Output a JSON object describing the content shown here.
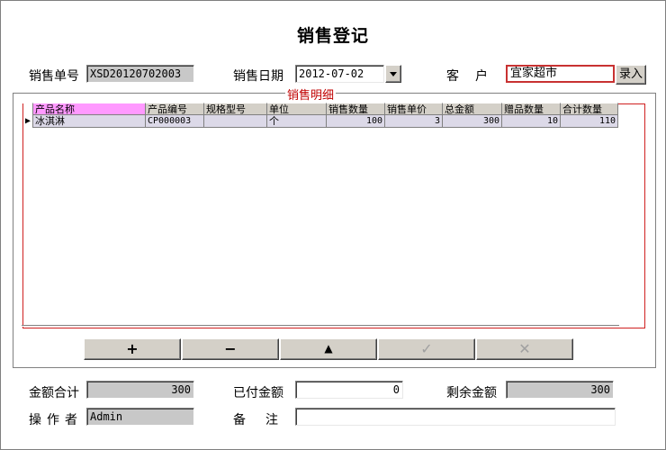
{
  "title": "销售登记",
  "header": {
    "order_no_label": "销售单号",
    "order_no": "XSD20120702003",
    "date_label": "销售日期",
    "date": "2012-07-02",
    "customer_label": "客　户",
    "customer": "宜家超市",
    "enter_label": "录入"
  },
  "detail": {
    "group_title": "销售明细",
    "columns": [
      "产品名称",
      "产品编号",
      "规格型号",
      "单位",
      "销售数量",
      "销售单价",
      "总金额",
      "赠品数量",
      "合计数量"
    ],
    "rows": [
      [
        "冰淇淋",
        "CP000003",
        "",
        "个",
        "100",
        "3",
        "300",
        "10",
        "110"
      ]
    ]
  },
  "toolbar": {
    "add": "+",
    "delete": "−",
    "up": "▲",
    "confirm": "✓",
    "cancel": "✕"
  },
  "footer": {
    "total_label": "金额合计",
    "total": "300",
    "paid_label": "已付金额",
    "paid": "0",
    "remaining_label": "剩余金额",
    "remaining": "300",
    "operator_label": "操作者",
    "operator": "Admin",
    "remark_label": "备　注",
    "remark": ""
  }
}
